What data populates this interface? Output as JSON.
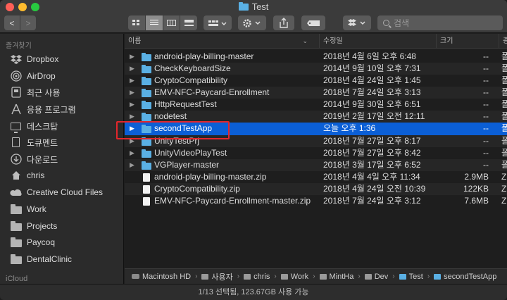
{
  "window": {
    "title": "Test"
  },
  "toolbar": {
    "back_glyph": "<",
    "forward_glyph": ">",
    "view_modes": [
      "icons",
      "list",
      "columns",
      "gallery"
    ],
    "active_view": "list",
    "search_placeholder": "검색"
  },
  "sidebar": {
    "favorites_label": "즐겨찾기",
    "items": [
      {
        "label": "Dropbox",
        "icon": "dropbox-icon"
      },
      {
        "label": "AirDrop",
        "icon": "airdrop-icon"
      },
      {
        "label": "최근 사용",
        "icon": "recents-icon"
      },
      {
        "label": "응용 프로그램",
        "icon": "applications-icon"
      },
      {
        "label": "데스크탑",
        "icon": "desktop-icon"
      },
      {
        "label": "도큐멘트",
        "icon": "documents-icon"
      },
      {
        "label": "다운로드",
        "icon": "downloads-icon"
      },
      {
        "label": "chris",
        "icon": "home-icon"
      },
      {
        "label": "Creative Cloud Files",
        "icon": "creative-cloud-icon"
      },
      {
        "label": "Work",
        "icon": "folder-icon"
      },
      {
        "label": "Projects",
        "icon": "folder-icon"
      },
      {
        "label": "Paycoq",
        "icon": "folder-icon"
      },
      {
        "label": "DentalClinic",
        "icon": "folder-icon"
      }
    ],
    "icloud_label": "iCloud"
  },
  "columns": {
    "name": "이름",
    "date": "수정일",
    "size": "크기",
    "kind": "종"
  },
  "files": [
    {
      "name": "android-play-billing-master",
      "date": "2018년 4월 6일 오후 6:48",
      "size": "--",
      "kind": "폴",
      "type": "folder"
    },
    {
      "name": "CheckKeyboardSize",
      "date": "2014년 9월 10일 오후 7:31",
      "size": "--",
      "kind": "폴",
      "type": "folder"
    },
    {
      "name": "CryptoCompatibility",
      "date": "2018년 4월 24일 오후 1:45",
      "size": "--",
      "kind": "폴",
      "type": "folder"
    },
    {
      "name": "EMV-NFC-Paycard-Enrollment",
      "date": "2018년 7월 24일 오후 3:13",
      "size": "--",
      "kind": "폴",
      "type": "folder"
    },
    {
      "name": "HttpRequestTest",
      "date": "2014년 9월 30일 오후 6:51",
      "size": "--",
      "kind": "폴",
      "type": "folder"
    },
    {
      "name": "nodetest",
      "date": "2019년 2월 17일 오전 12:11",
      "size": "--",
      "kind": "폴",
      "type": "folder"
    },
    {
      "name": "secondTestApp",
      "date": "오늘 오후 1:36",
      "size": "--",
      "kind": "폴",
      "type": "folder",
      "selected": true
    },
    {
      "name": "UnityTestPrj",
      "date": "2018년 7월 27일 오후 8:17",
      "size": "--",
      "kind": "폴",
      "type": "folder"
    },
    {
      "name": "UnityVideoPlayTest",
      "date": "2018년 7월 27일 오후 8:42",
      "size": "--",
      "kind": "폴",
      "type": "folder"
    },
    {
      "name": "VGPlayer-master",
      "date": "2018년 3월 17일 오후 6:52",
      "size": "--",
      "kind": "폴",
      "type": "folder"
    },
    {
      "name": "android-play-billing-master.zip",
      "date": "2018년 4월 4일 오후 11:34",
      "size": "2.9MB",
      "kind": "Z",
      "type": "file"
    },
    {
      "name": "CryptoCompatibility.zip",
      "date": "2018년 4월 24일 오전 10:39",
      "size": "122KB",
      "kind": "Z",
      "type": "file"
    },
    {
      "name": "EMV-NFC-Paycard-Enrollment-master.zip",
      "date": "2018년 7월 24일 오후 3:12",
      "size": "7.6MB",
      "kind": "Z",
      "type": "file"
    }
  ],
  "path": [
    "Macintosh HD",
    "사용자",
    "chris",
    "Work",
    "MintHa",
    "Dev",
    "Test",
    "secondTestApp"
  ],
  "status": "1/13 선택됨, 123.67GB 사용 가능",
  "colors": {
    "selection": "#0b5fd6",
    "folder": "#5ab0e4",
    "highlight_box": "#e3262b"
  }
}
